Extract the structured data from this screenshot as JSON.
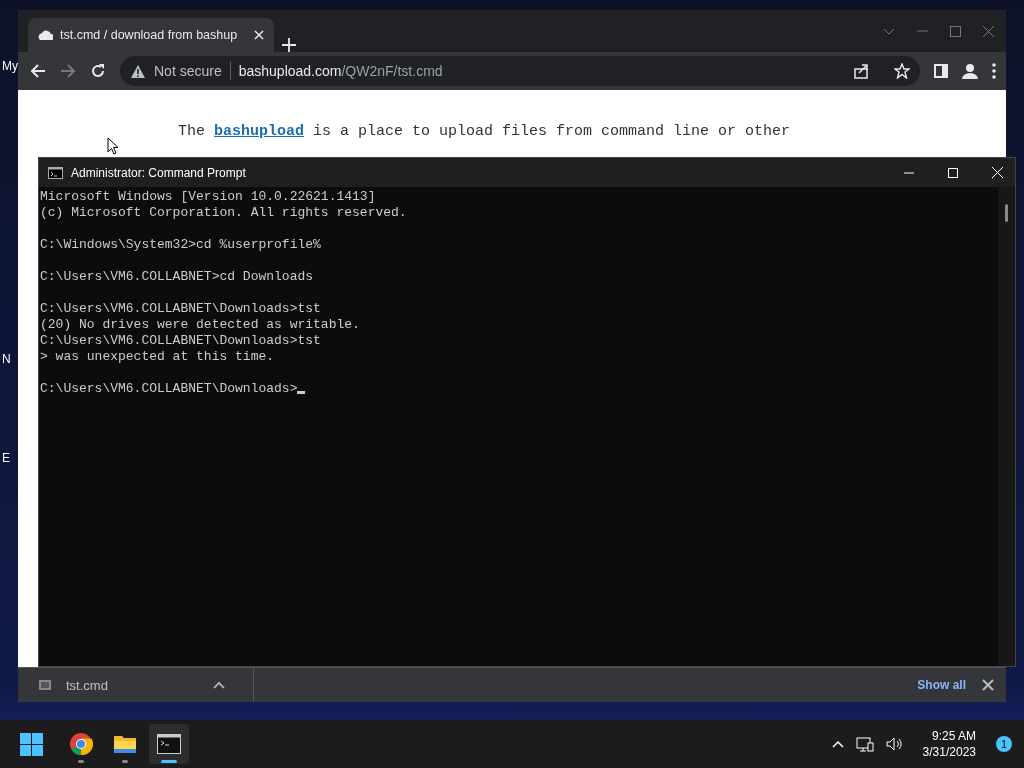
{
  "desktop": {
    "icon_labels": [
      "My",
      "N",
      "E"
    ]
  },
  "browser": {
    "tab": {
      "title": "tst.cmd / download from bashup",
      "selected": true
    },
    "address": {
      "security": "Not secure",
      "host": "bashupload.com",
      "path": "/QW2nF/tst.cmd"
    },
    "page": {
      "text_before": "The ",
      "link": "bashupload",
      "text_after": " is a place to upload files from command line or other"
    },
    "download_bar": {
      "file": "tst.cmd",
      "show_all": "Show all"
    }
  },
  "cmd": {
    "title": "Administrator: Command Prompt",
    "cursor": true,
    "blocks": [
      [
        "Microsoft Windows [Version 10.0.22621.1413]",
        "(c) Microsoft Corporation. All rights reserved."
      ],
      [
        "C:\\Windows\\System32>cd %userprofile%"
      ],
      [
        "C:\\Users\\VM6.COLLABNET>cd Downloads"
      ],
      [
        "C:\\Users\\VM6.COLLABNET\\Downloads>tst",
        "(20) No drives were detected as writable.",
        "C:\\Users\\VM6.COLLABNET\\Downloads>tst",
        "> was unexpected at this time."
      ],
      [
        "C:\\Users\\VM6.COLLABNET\\Downloads>"
      ]
    ]
  },
  "taskbar": {
    "apps": [
      {
        "kind": "chrome",
        "running": true,
        "selected": false
      },
      {
        "kind": "explorer",
        "running": true,
        "selected": false
      },
      {
        "kind": "terminal",
        "running": true,
        "selected": true
      }
    ],
    "time": "9:25 AM",
    "date": "3/31/2023",
    "notifications": "1"
  }
}
